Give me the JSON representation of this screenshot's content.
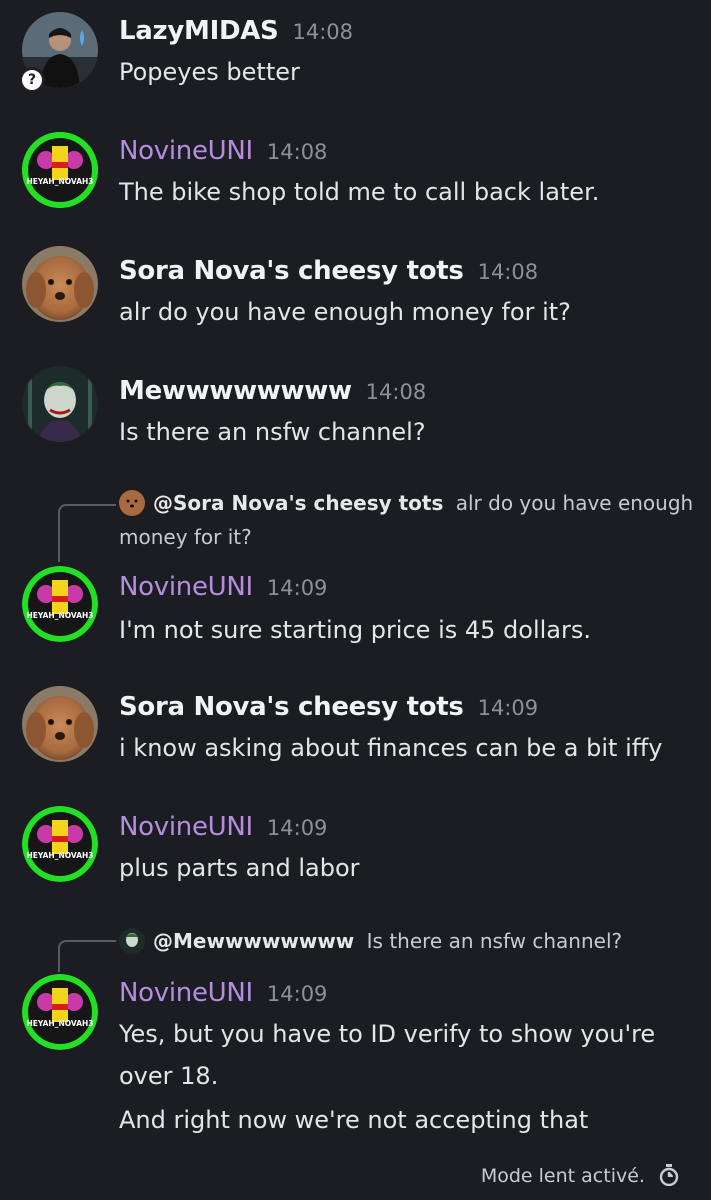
{
  "colors": {
    "background": "#1c1d22",
    "nickname_purple": "#b58de0",
    "text": "#e4e5e8",
    "timestamp": "#8e9098"
  },
  "messages": [
    {
      "author": "LazyMIDAS",
      "time": "14:08",
      "text": "Popeyes better",
      "avatar": "photo-avatar-dark"
    },
    {
      "author": "NovineUNI",
      "time": "14:08",
      "text": "The bike shop told me to call back later.",
      "avatar": "heyah-novine-logo"
    },
    {
      "author": "Sora Nova's cheesy tots",
      "time": "14:08",
      "text": "alr do you have enough money for it?",
      "avatar": "dog-avatar"
    },
    {
      "author": "Mewwwwwwww",
      "time": "14:08",
      "text": "Is there an nsfw channel?",
      "avatar": "joker-avatar"
    },
    {
      "reply_to": {
        "mention": "@Sora Nova's cheesy tots",
        "text_line1": "alr do you have enough",
        "text_line2": "money for it?"
      },
      "author": "NovineUNI",
      "time": "14:09",
      "text": "I'm not sure starting price is 45 dollars.",
      "avatar": "heyah-novine-logo"
    },
    {
      "author": "Sora Nova's cheesy tots",
      "time": "14:09",
      "text": "i know asking about finances can be a bit iffy",
      "avatar": "dog-avatar"
    },
    {
      "author": "NovineUNI",
      "time": "14:09",
      "text": "plus parts and labor",
      "avatar": "heyah-novine-logo"
    },
    {
      "reply_to": {
        "mention": "@Mewwwwwwww",
        "text": "Is there an nsfw channel?"
      },
      "author": "NovineUNI",
      "time": "14:09",
      "text_line1": "Yes, but you have to ID verify to show you're",
      "text_line2": "over 18.",
      "text_line3": "And right now we're not accepting that",
      "avatar": "heyah-novine-logo"
    }
  ],
  "avatar_logo_text": "HEYAH_NOVAH3",
  "footer": {
    "slowmode": "Mode lent activé.",
    "icon": "stopwatch-icon"
  }
}
